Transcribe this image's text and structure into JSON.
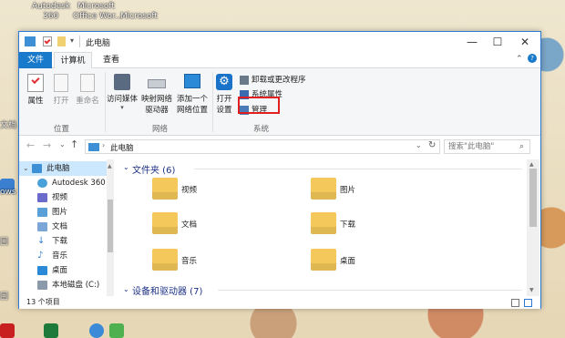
{
  "desktop": {
    "icons": [
      {
        "label": "Autodesk",
        "line2": "360"
      },
      {
        "label": "Microsoft",
        "line2": "Office Wor..."
      },
      {
        "label": "Microsoft",
        "line2": ""
      }
    ],
    "left_labels": [
      "文档",
      "ows",
      "回",
      "回"
    ]
  },
  "window": {
    "title": "此电脑",
    "controls": {
      "minimize": "—",
      "maximize": "☐",
      "close": "✕"
    }
  },
  "tabs": {
    "file": "文件",
    "computer": "计算机",
    "view": "查看"
  },
  "ribbon": {
    "location_group": {
      "properties": "属性",
      "open": "打开",
      "rename": "重命名",
      "label": "位置"
    },
    "network_group": {
      "access_media": "访问媒体",
      "map_drive_1": "映射网络",
      "map_drive_2": "驱动器",
      "add_location_1": "添加一个",
      "add_location_2": "网络位置",
      "label": "网络"
    },
    "system_group": {
      "open_settings_1": "打开",
      "open_settings_2": "设置",
      "uninstall": "卸载或更改程序",
      "system_props": "系统属性",
      "manage": "管理",
      "label": "系统"
    }
  },
  "address": {
    "path": "此电脑",
    "search_placeholder": "搜索\"此电脑\""
  },
  "nav": {
    "items": [
      {
        "label": "此电脑",
        "color": "#3d8fd6"
      },
      {
        "label": "Autodesk 360",
        "color": "#4aa0d8"
      },
      {
        "label": "视频",
        "color": "#6b6bcc"
      },
      {
        "label": "图片",
        "color": "#5aa0d8"
      },
      {
        "label": "文档",
        "color": "#7ba6d8"
      },
      {
        "label": "下载",
        "color": "#2f7fd0"
      },
      {
        "label": "音乐",
        "color": "#2f7fd0"
      },
      {
        "label": "桌面",
        "color": "#2a8ad8"
      },
      {
        "label": "本地磁盘 (C:)",
        "color": "#8a9aaa"
      }
    ]
  },
  "content": {
    "folders_header": "文件夹 (6)",
    "folders": [
      {
        "label": "视频"
      },
      {
        "label": "图片"
      },
      {
        "label": "文档"
      },
      {
        "label": "下载"
      },
      {
        "label": "音乐"
      },
      {
        "label": "桌面"
      }
    ],
    "devices_header": "设备和驱动器 (7)"
  },
  "status": {
    "count": "13 个项目"
  },
  "colors": {
    "accent": "#1979ca",
    "highlight_box": "#e02020",
    "folder": "#f4c85a"
  }
}
